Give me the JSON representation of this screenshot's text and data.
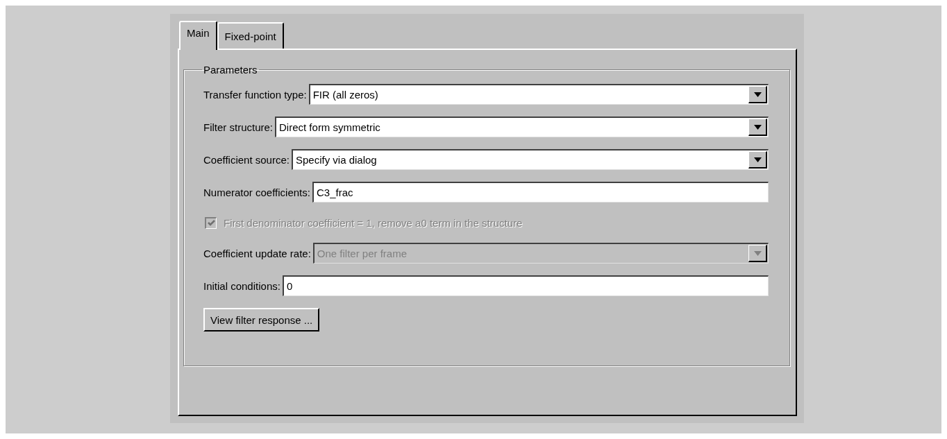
{
  "tabs": [
    {
      "label": "Main",
      "selected": true
    },
    {
      "label": "Fixed-point",
      "selected": false
    }
  ],
  "group": {
    "title": "Parameters",
    "rows": [
      {
        "kind": "dropdown",
        "label": "Transfer function type:",
        "value": "FIR (all zeros)",
        "disabled": false
      },
      {
        "kind": "dropdown",
        "label": "Filter structure:",
        "value": "Direct form symmetric",
        "disabled": false
      },
      {
        "kind": "dropdown",
        "label": "Coefficient source:",
        "value": "Specify via dialog",
        "disabled": false
      },
      {
        "kind": "text",
        "label": "Numerator coefficients:",
        "value": "C3_frac",
        "disabled": false
      },
      {
        "kind": "checkbox",
        "label": "First denominator coefficient = 1, remove a0 term in the structure",
        "checked": true,
        "disabled": true
      },
      {
        "kind": "dropdown",
        "label": "Coefficient update rate:",
        "value": "One filter per frame",
        "disabled": true
      },
      {
        "kind": "text",
        "label": "Initial conditions:",
        "value": "0",
        "disabled": false
      },
      {
        "kind": "button",
        "label": "View filter response ..."
      }
    ]
  }
}
